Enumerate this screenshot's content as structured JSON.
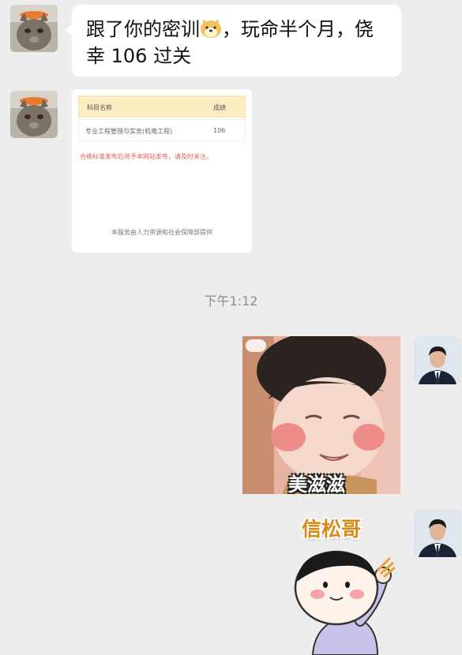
{
  "messages": {
    "first_text": "跟了你的密训",
    "first_text_after_emoji": "，玩命半个月，侥幸 106 过关",
    "emoji_icon": "doge-face-icon"
  },
  "score_card": {
    "header_subject": "科目名称",
    "header_score": "成绩",
    "row_subject": "专业工程管理与实务(机电工程)",
    "row_score": "106",
    "notice": "合格标准发布后将予本网站发布，请及时关注。",
    "footer": "本服务由人力资源和社会保障部提供"
  },
  "timestamp": "下午1:12",
  "stickers": {
    "baby_caption": "美滋滋",
    "boy_caption": "信松哥"
  },
  "colors": {
    "background": "#ededed",
    "bubble": "#ffffff",
    "card_header": "#fbeec3",
    "notice_red": "#e06060",
    "sticker_caption_orange": "#d9891a"
  }
}
